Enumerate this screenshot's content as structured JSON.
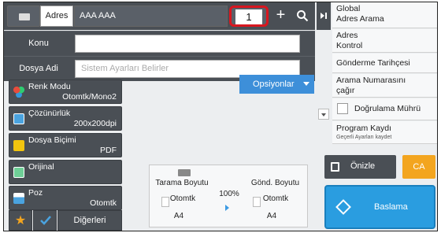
{
  "header": {
    "address_tab": "Adres",
    "address_value": "AAA AAA",
    "count": "1",
    "plus_label": "+"
  },
  "form": {
    "subject_label": "Konu",
    "subject_value": "",
    "filename_label": "Dosya Adi",
    "filename_placeholder": "Sistem Ayarları Belirler"
  },
  "settings": {
    "color_mode": {
      "label": "Renk Modu",
      "value": "Otomtk/Mono2"
    },
    "resolution": {
      "label": "Çözünürlük",
      "value": "200x200dpi"
    },
    "file_format": {
      "label": "Dosya Biçimi",
      "value": "PDF"
    },
    "original": {
      "label": "Orijinal"
    },
    "exposure": {
      "label": "Poz",
      "value": "Otomtk"
    }
  },
  "options_label": "Opsiyonlar",
  "others_label": "Diğerleri",
  "preview": {
    "scan_size_label": "Tarama Boyutu",
    "scan_value": "Otomtk",
    "scan_paper": "A4",
    "ratio": "100%",
    "send_size_label": "Gönd. Boyutu",
    "send_value": "Otomtk",
    "send_paper": "A4"
  },
  "right_panel": {
    "global_search": "Global\nAdres Arama",
    "address_check": "Adres\nKontrol",
    "send_history": "Gönderme Tarihçesi",
    "call_number": "Arama Numarasını\nçağır",
    "verify_stamp": "Doğrulama Mührü",
    "program_record": "Program Kaydı",
    "program_sub": "Geçerli Ayarları kaydet"
  },
  "actions": {
    "preview": "Önizle",
    "ca": "CA",
    "start": "Baslama"
  },
  "colors": {
    "dark_panel": "#4a4f55",
    "accent_blue": "#2a9de0",
    "option_blue": "#3d8fd9",
    "ca_orange": "#f3a51f",
    "highlight_red": "#d8161f"
  }
}
